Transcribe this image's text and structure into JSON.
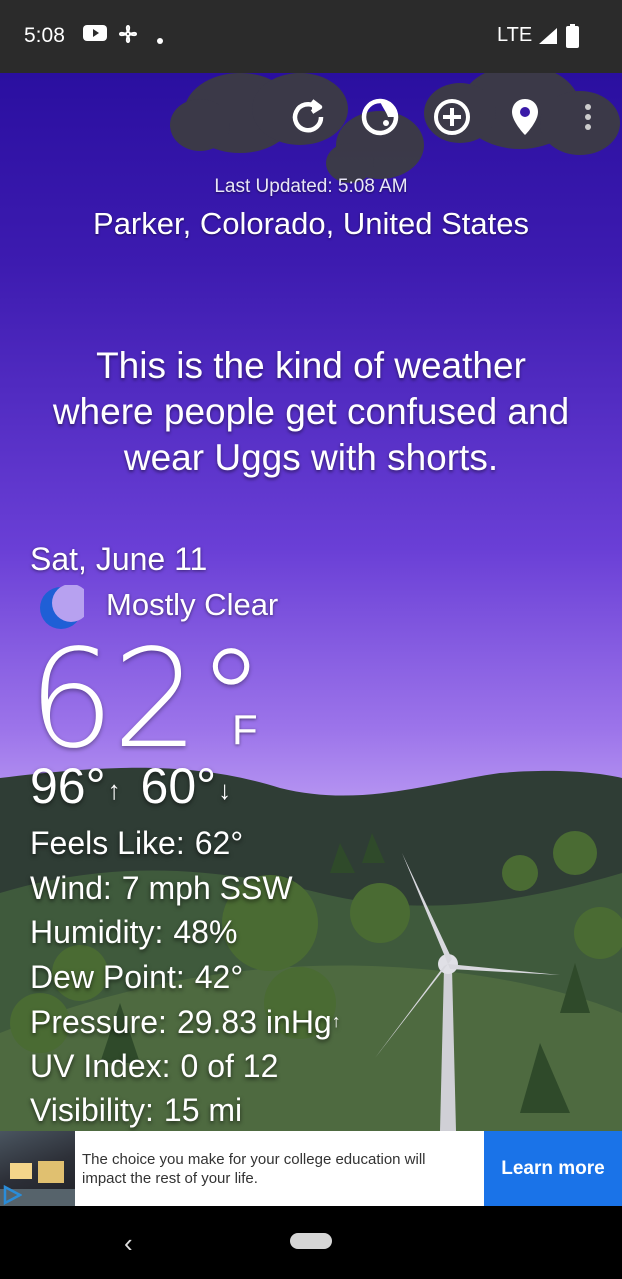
{
  "status_bar": {
    "time": "5:08",
    "network": "LTE",
    "icons": [
      "youtube-icon",
      "pinwheel-icon",
      "dot-icon",
      "signal-icon",
      "battery-icon"
    ]
  },
  "toolbar": {
    "icons": [
      "refresh-icon",
      "theme-icon",
      "add-location-icon",
      "location-pin-icon",
      "more-options-icon"
    ]
  },
  "header": {
    "last_updated": "Last Updated: 5:08 AM",
    "location": "Parker, Colorado, United States"
  },
  "quote": {
    "line1": "This is the kind of weather",
    "line2": "where people get confused and",
    "line3": "wear Uggs with shorts."
  },
  "current": {
    "date": "Sat, June 11",
    "condition": "Mostly Clear",
    "condition_icon": "moon-icon",
    "temperature": "62°",
    "unit": "F",
    "high": "96°",
    "high_arrow": "↑",
    "low": "60°",
    "low_arrow": "↓"
  },
  "details": {
    "feels_like_label": "Feels Like:",
    "feels_like": "62°",
    "wind_label": "Wind:",
    "wind": "7 mph SSW",
    "humidity_label": "Humidity:",
    "humidity": "48%",
    "dew_point_label": "Dew Point:",
    "dew_point": "42°",
    "pressure_label": "Pressure:",
    "pressure": "29.83 inHg",
    "pressure_trend": "↑",
    "uv_label": "UV Index:",
    "uv": "0 of 12",
    "visibility_label": "Visibility:",
    "visibility": "15 mi"
  },
  "ad": {
    "text": "The choice you make for your college education will impact the rest of your life.",
    "cta": "Learn more"
  },
  "nav": {
    "back": "‹"
  },
  "colors": {
    "sky_top": "#2a0fa0",
    "sky_bottom": "#c2a4f5",
    "ad_button": "#1a73e8"
  }
}
